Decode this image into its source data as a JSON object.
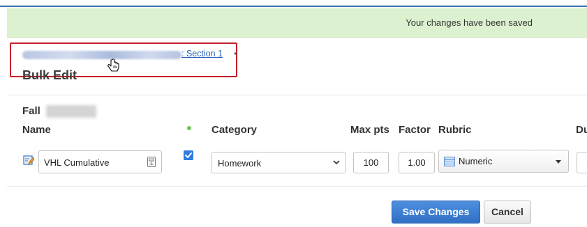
{
  "notice": {
    "message": "Your changes have been saved"
  },
  "breadcrumb": {
    "section_link": ": Section 1",
    "separator": "▸"
  },
  "page": {
    "title": "Bulk Edit",
    "term_label": "Fall"
  },
  "table": {
    "headers": {
      "name": "Name",
      "category": "Category",
      "max_pts": "Max pts",
      "factor": "Factor",
      "rubric": "Rubric",
      "due": "Du"
    },
    "row": {
      "name": "VHL Cumulative",
      "checked": true,
      "category": "Homework",
      "max_pts": "100",
      "factor": "1.00",
      "rubric": "Numeric"
    }
  },
  "actions": {
    "save_label": "Save Changes",
    "cancel_label": "Cancel"
  },
  "colors": {
    "accent": "#2f6fc5",
    "success_bg": "#dcf1cf",
    "highlight_border": "#c8202a",
    "status_dot": "#72c356"
  },
  "icons": [
    "hand-pointer-icon",
    "edit-icon",
    "badge-icon",
    "checkmark-icon",
    "chevron-down-icon",
    "rubric-icon",
    "caret-down-icon"
  ]
}
